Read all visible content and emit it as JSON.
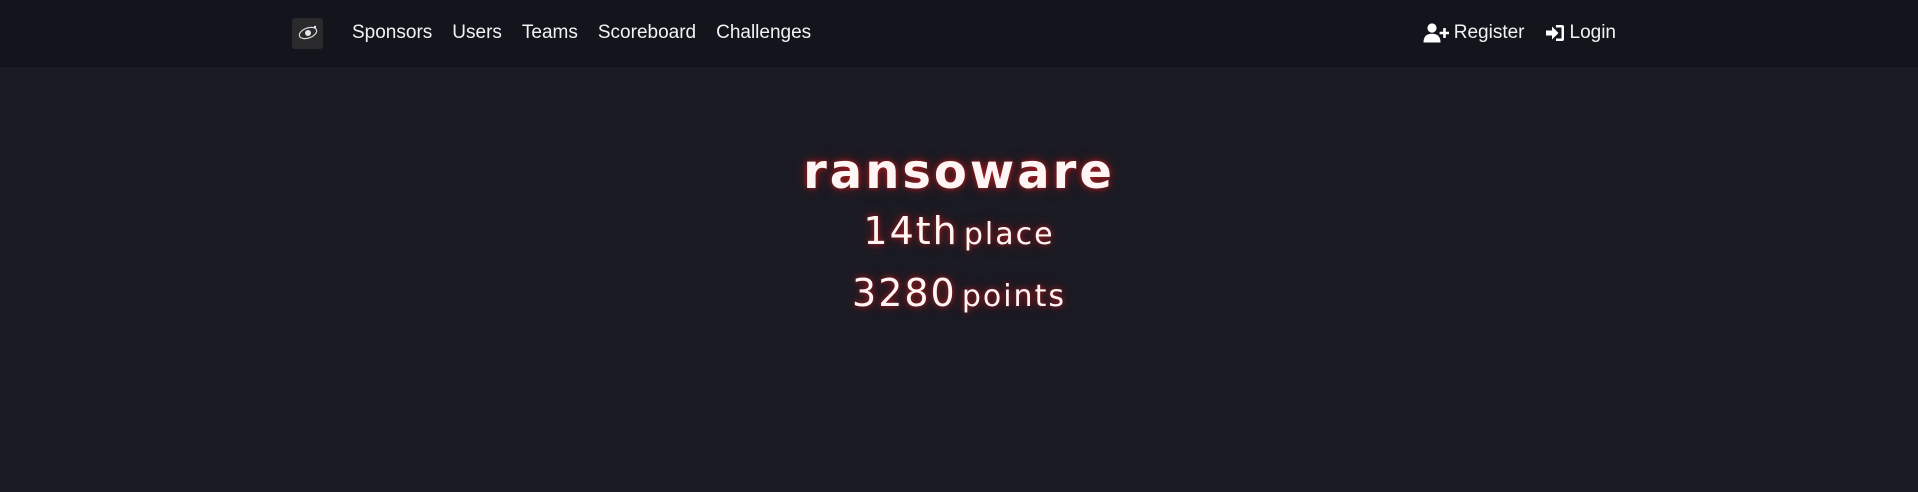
{
  "nav": {
    "logo_icon": "ctf-logo-icon",
    "links": [
      {
        "label": "Sponsors"
      },
      {
        "label": "Users"
      },
      {
        "label": "Teams"
      },
      {
        "label": "Scoreboard"
      },
      {
        "label": "Challenges"
      }
    ],
    "register": {
      "label": "Register",
      "icon": "user-plus-icon"
    },
    "login": {
      "label": "Login",
      "icon": "sign-in-icon"
    }
  },
  "team": {
    "name": "ransoware",
    "place_number": "14th",
    "place_word": "place",
    "points_number": "3280",
    "points_word": "points"
  },
  "colors": {
    "background": "#1a1b24",
    "navbar": "#13151d",
    "glow": "#c81e1e"
  }
}
